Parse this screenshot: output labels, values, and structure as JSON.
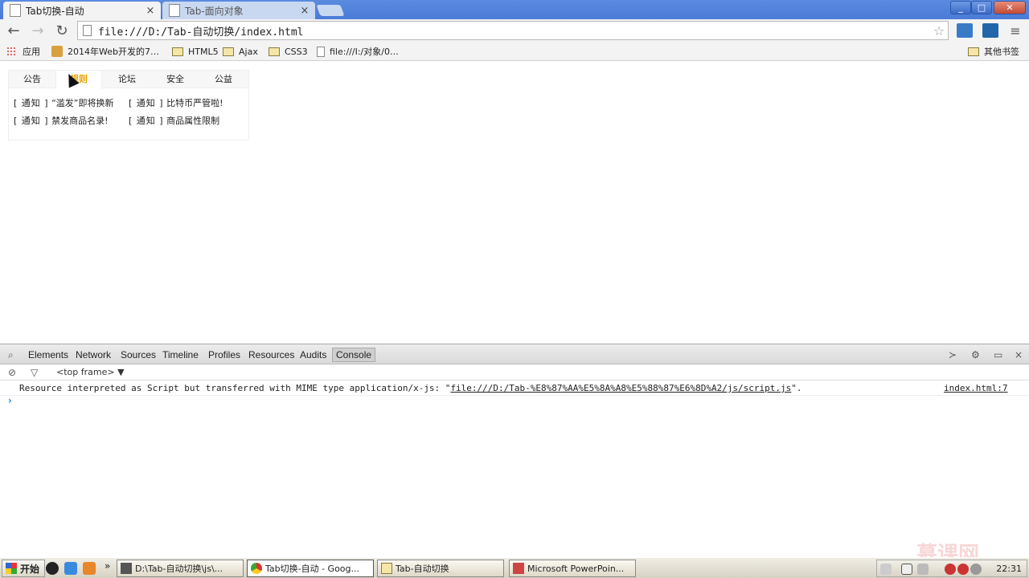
{
  "browser": {
    "tabs": [
      {
        "label": "Tab切换-自动",
        "active": true
      },
      {
        "label": "Tab-面向对象",
        "active": false
      }
    ],
    "close_glyph": "×",
    "url": "file:///D:/Tab-自动切换/index.html",
    "bookmarks": [
      {
        "label": "应用",
        "icon": "apps-icon"
      },
      {
        "label": "2014年Web开发的7…",
        "icon": "bookmark-icon"
      },
      {
        "label": "HTML5",
        "icon": "folder-icon"
      },
      {
        "label": "Ajax",
        "icon": "folder-icon"
      },
      {
        "label": "CSS3",
        "icon": "folder-icon"
      },
      {
        "label": "file:///I:/对象/0…",
        "icon": "page-icon"
      },
      {
        "label": "其他书签",
        "icon": "folder-icon"
      }
    ]
  },
  "page": {
    "notice_tabs": [
      {
        "label": "公告",
        "active": false
      },
      {
        "label": "规则",
        "active": true
      },
      {
        "label": "论坛",
        "active": false
      },
      {
        "label": "安全",
        "active": false
      },
      {
        "label": "公益",
        "active": false
      }
    ],
    "notice_items": [
      {
        "tag": "[ 通知 ]",
        "text": "“滥发”即将换新"
      },
      {
        "tag": "[ 通知 ]",
        "text": "比特币严管啦!"
      },
      {
        "tag": "[ 通知 ]",
        "text": "禁发商品名录!"
      },
      {
        "tag": "[ 通知 ]",
        "text": "商品属性限制"
      }
    ]
  },
  "devtools": {
    "tabs": [
      "Elements",
      "Network",
      "Sources",
      "Timeline",
      "Profiles",
      "Resources",
      "Audits",
      "Console"
    ],
    "active_tab": "Console",
    "frame": "<top frame>",
    "console_message": {
      "prefix": "Resource interpreted as Script but transferred with MIME type application/x-js: \"",
      "link": "file:///D:/Tab-%E8%87%AA%E5%8A%A8%E5%88%87%E6%8D%A2/js/script.js",
      "suffix": "\".",
      "source": "index.html:7"
    },
    "prompt": "›"
  },
  "taskbar": {
    "start_label": "开始",
    "tasks": [
      {
        "label": "D:\\Tab-自动切换\\js\\...",
        "active": false
      },
      {
        "label": "Tab切换-自动 - Goog...",
        "active": true
      },
      {
        "label": "Tab-自动切换",
        "active": false
      },
      {
        "label": "Microsoft PowerPoin...",
        "active": false
      }
    ],
    "overflow": "»",
    "clock": "22:31"
  },
  "watermark": "慕课网",
  "colors": {
    "active_notice_tab": "#e8a000",
    "titlebar": "#4a7bd6",
    "console_prompt": "#2a7fde"
  }
}
